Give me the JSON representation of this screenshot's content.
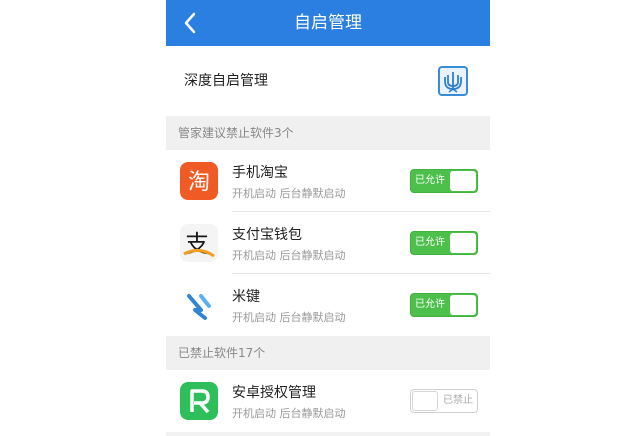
{
  "nav": {
    "title": "自启管理"
  },
  "deep_manage": {
    "label": "深度自启管理"
  },
  "sections": [
    {
      "label": "管家建议禁止软件3个"
    },
    {
      "label": "已禁止软件17个"
    }
  ],
  "apps": [
    {
      "name": "手机淘宝",
      "detail": "开机启动 后台静默启动",
      "status": "已允许",
      "icon": "taobao-icon"
    },
    {
      "name": "支付宝钱包",
      "detail": "开机启动 后台静默启动",
      "status": "已允许",
      "icon": "alipay-icon"
    },
    {
      "name": "米键",
      "detail": "开机启动 后台静默启动",
      "status": "已允许",
      "icon": "mijian-icon"
    },
    {
      "name": "安卓授权管理",
      "detail": "开机启动 后台静默启动",
      "status": "已禁止",
      "icon": "android-auth-icon"
    }
  ],
  "colors": {
    "nav": "#2a7fe0",
    "toggle_on": "#4cc04a"
  }
}
